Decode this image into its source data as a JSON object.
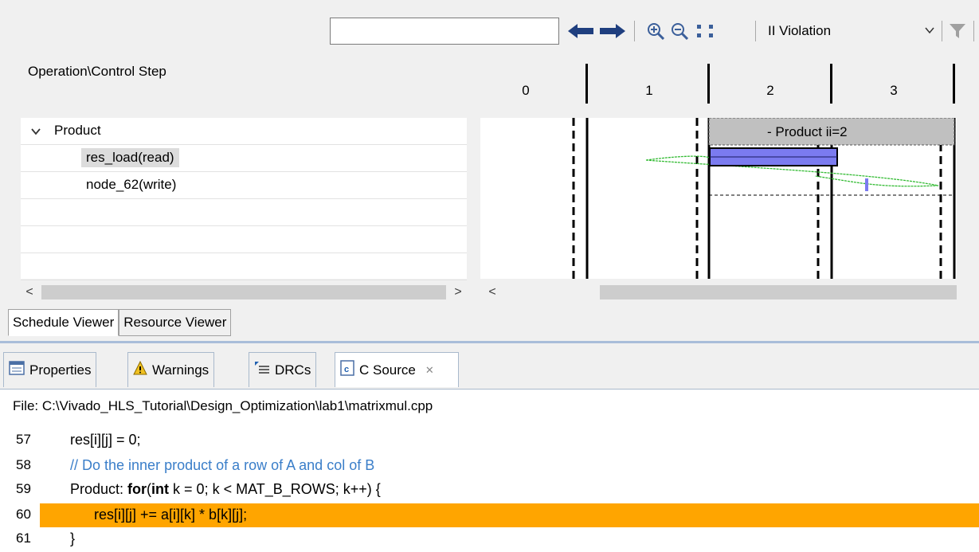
{
  "toolbar": {
    "search_value": "",
    "filter_selected": "II Violation",
    "icons": [
      "back-arrow-icon",
      "forward-arrow-icon",
      "zoom-in-icon",
      "zoom-out-icon",
      "fit-icon",
      "filter-icon"
    ]
  },
  "schedule": {
    "column_header": "Operation\\Control Step",
    "steps": [
      "0",
      "1",
      "2",
      "3"
    ],
    "tree": {
      "group": "Product",
      "items": [
        "res_load(read)",
        "node_62(write)"
      ]
    },
    "gantt_region_label": "- Product  ii=2"
  },
  "bottom_tabs": {
    "schedule_viewer": "Schedule Viewer",
    "resource_viewer": "Resource Viewer"
  },
  "view_tabs": {
    "properties": "Properties",
    "warnings": "Warnings",
    "drcs": "DRCs",
    "c_source": "C Source",
    "close_glyph": "✕"
  },
  "source": {
    "file_label": "File: C:\\Vivado_HLS_Tutorial\\Design_Optimization\\lab1\\matrixmul.cpp",
    "lines": [
      {
        "num": "57",
        "text": "res[i][j] = 0;"
      },
      {
        "num": "58",
        "text": "// Do the inner product of a row of A and col of B"
      },
      {
        "num": "59",
        "pre": "Product: ",
        "kw1": "for",
        "mid": "(",
        "kw2": "int",
        "post": " k = 0; k < MAT_B_ROWS; k++) {"
      },
      {
        "num": "60",
        "text": "res[i][j] += a[i][k] * b[k][j];"
      },
      {
        "num": "61",
        "text": "}"
      }
    ]
  },
  "colors": {
    "highlight": "#ffa500",
    "op_bar": "#7b7bf0",
    "dep_line": "#33bb33",
    "comment": "#3a7ec9"
  }
}
